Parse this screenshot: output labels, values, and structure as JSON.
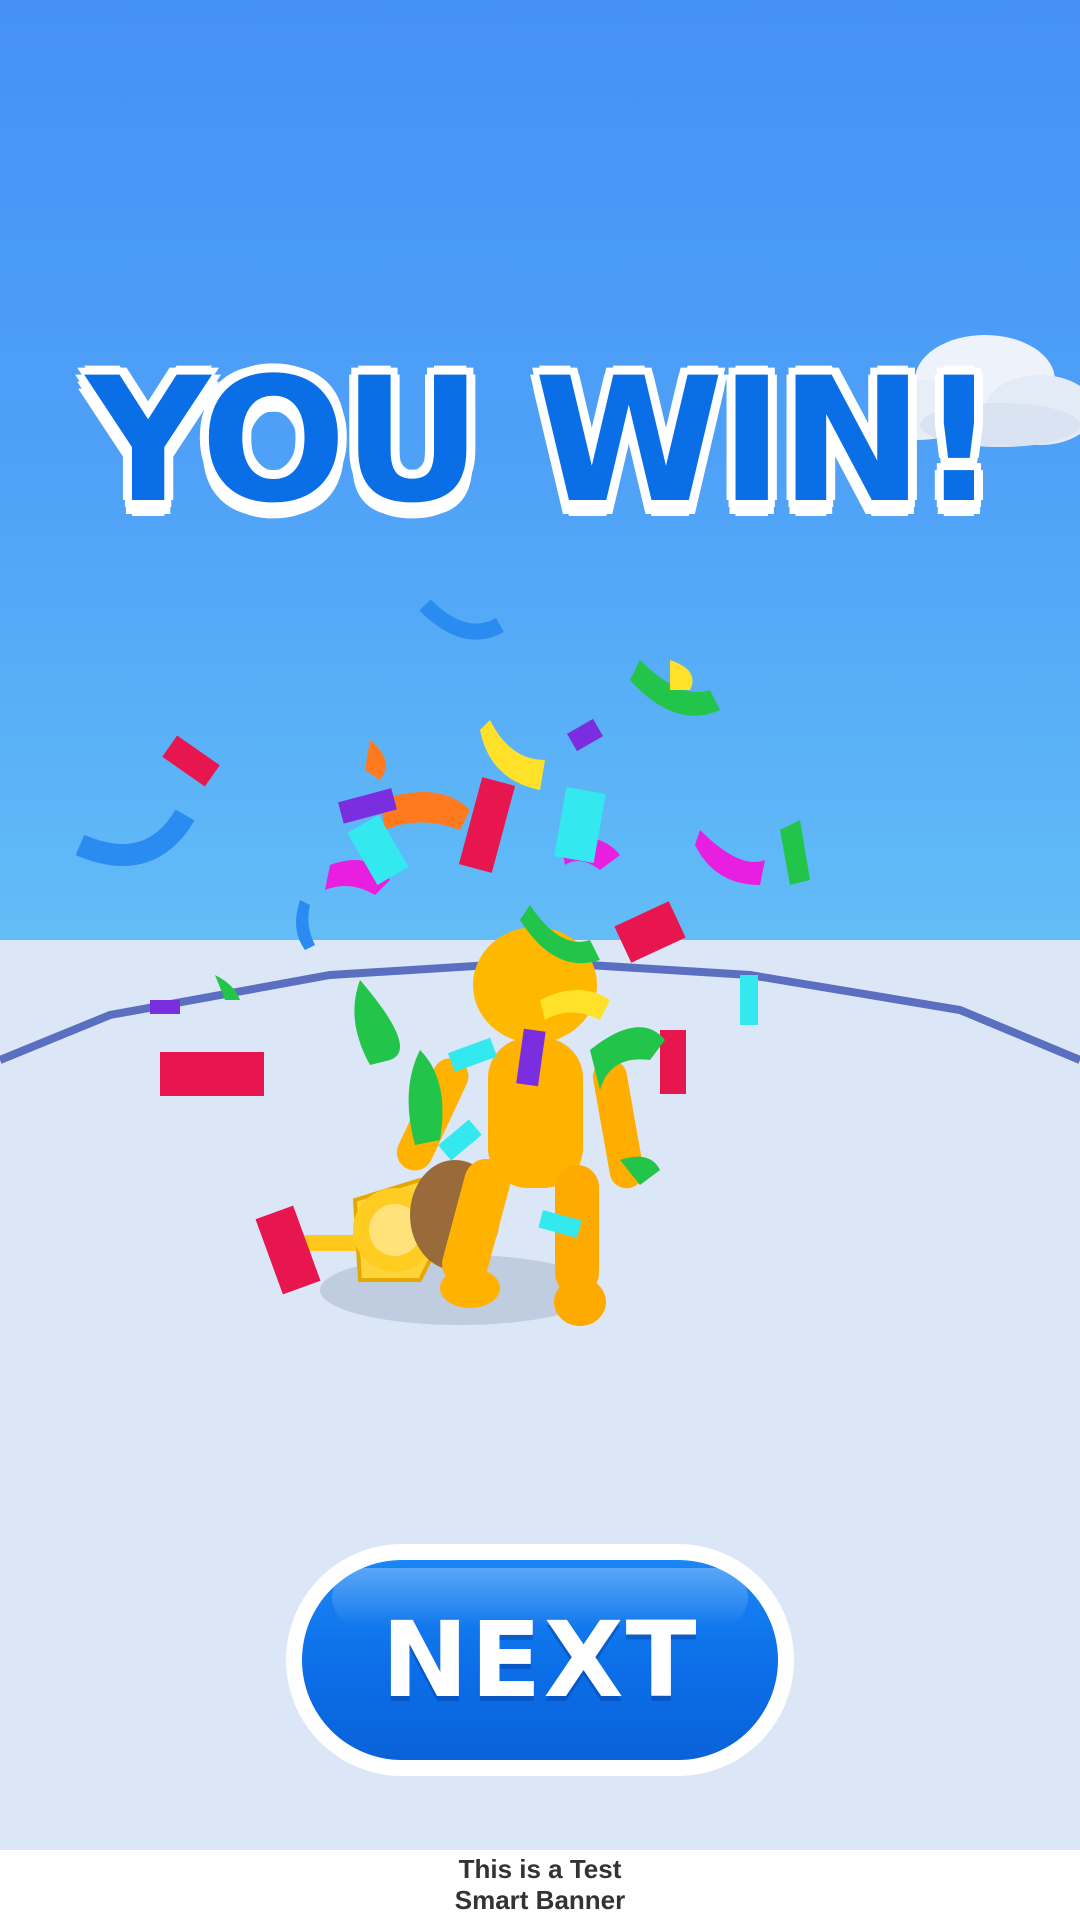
{
  "title": "YOU WIN!",
  "next_button": {
    "label": "NEXT"
  },
  "banner": {
    "line1": "This is a Test",
    "line2": "Smart Banner"
  },
  "colors": {
    "sky_top": "#4591f7",
    "sky_bottom": "#6cc4f5",
    "ground": "#dbe6f7",
    "accent_blue": "#0a6ee6",
    "character": "#ffb800"
  },
  "icons": [
    "cloud-icon",
    "trophy-icon",
    "confetti-icon",
    "character-figure"
  ]
}
